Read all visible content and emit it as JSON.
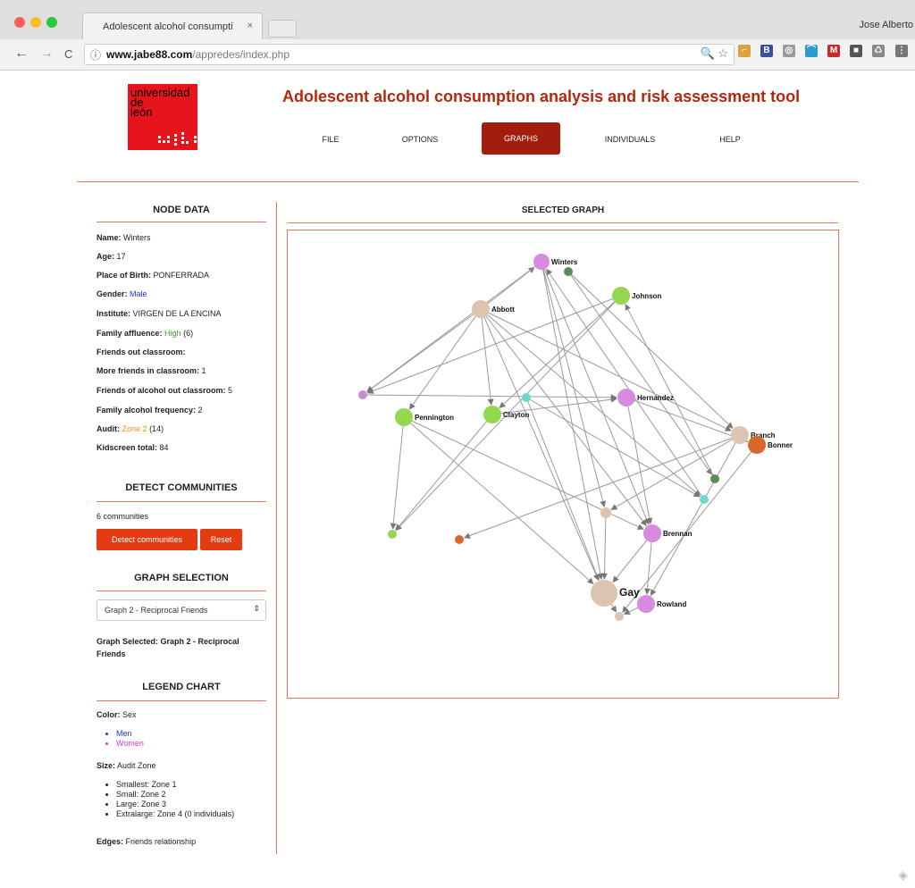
{
  "browser": {
    "tab_title": "Adolescent alcohol consumpti",
    "tab_close": "×",
    "user": "Jose Alberto",
    "url_host": "www.jabe88.com",
    "url_path": "/appredes/index.php",
    "back": "←",
    "forward": "→",
    "reload": "C",
    "info": "ⓘ",
    "omni_icons": "🔍 ☆",
    "extensions": [
      {
        "label": "⌐",
        "color": "#d9a23a"
      },
      {
        "label": "B",
        "color": "#3a4fa0"
      },
      {
        "label": "◎",
        "color": "#9a9a9a"
      },
      {
        "label": "⌒",
        "color": "#2e9ad0"
      },
      {
        "label": "M",
        "color": "#c42b2b"
      },
      {
        "label": "■",
        "color": "#555555"
      },
      {
        "label": "♺",
        "color": "#888888"
      },
      {
        "label": "⋮",
        "color": "#777777"
      }
    ]
  },
  "header": {
    "logo_text_1": "universidad",
    "logo_text_2": "de",
    "logo_text_3": "león",
    "title": "Adolescent alcohol consumption analysis and risk assessment tool",
    "nav": [
      "FILE",
      "OPTIONS",
      "GRAPHS",
      "INDIVIDUALS",
      "HELP"
    ],
    "active_nav": "GRAPHS"
  },
  "node_data": {
    "title": "NODE DATA",
    "name_label": "Name:",
    "name": "Winters",
    "age_label": "Age:",
    "age": "17",
    "pob_label": "Place of Birth:",
    "pob": "PONFERRADA",
    "gender_label": "Gender:",
    "gender": "Male",
    "institute_label": "Institute:",
    "institute": "VIRGEN DE LA ENCINA",
    "affluence_label": "Family affluence:",
    "affluence": "High",
    "affluence_score": "(6)",
    "friends_out_label": "Friends out classroom:",
    "more_friends_label": "More friends in classroom:",
    "more_friends": "1",
    "friends_alcohol_label": "Friends of alcohol out classroom:",
    "friends_alcohol": "5",
    "family_alcohol_label": "Family alcohol frequency:",
    "family_alcohol": "2",
    "audit_label": "Audit:",
    "audit_zone": "Zone 2",
    "audit_score": "(14)",
    "kidscreen_label": "Kidscreen total:",
    "kidscreen": "84"
  },
  "communities": {
    "title": "DETECT COMMUNITIES",
    "count_text": "6 communities",
    "detect_button": "Detect communities",
    "reset_button": "Reset"
  },
  "graph_selection": {
    "title": "GRAPH SELECTION",
    "selected_option": "Graph 2 - Reciprocal Friends",
    "arrow": "⇕",
    "selected_label": "Graph Selected:",
    "selected_value_1": "Graph 2 - Reciprocal",
    "selected_value_2": "Friends"
  },
  "legend": {
    "title": "LEGEND CHART",
    "color_label": "Color:",
    "color_value": "Sex",
    "men": "Men",
    "women": "Women",
    "size_label": "Size:",
    "size_value": "Audit Zone",
    "sizes": [
      "Smallest: Zone 1",
      "Small: Zone 2",
      "Large: Zone 3",
      "Extralarge: Zone 4 (0 individuals)"
    ],
    "edges_label": "Edges:",
    "edges_value": "Friends relationship"
  },
  "graph": {
    "title": "SELECTED GRAPH",
    "nodes": [
      {
        "label": "Winters",
        "color": "#d68be0"
      },
      {
        "label": "",
        "color": "#5b8a5b"
      },
      {
        "label": "Johnson",
        "color": "#93d84f"
      },
      {
        "label": "Abbott",
        "color": "#dcc4b0"
      },
      {
        "label": "",
        "color": "#c98bd6"
      },
      {
        "label": "",
        "color": "#6ed8c8"
      },
      {
        "label": "Hernandez",
        "color": "#d68be0"
      },
      {
        "label": "Pennington",
        "color": "#93d84f"
      },
      {
        "label": "Clayton",
        "color": "#93d84f"
      },
      {
        "label": "Branch",
        "color": "#dcc4b0"
      },
      {
        "label": "Bonner",
        "color": "#d8692b"
      },
      {
        "label": "",
        "color": "#5b8a5b"
      },
      {
        "label": "",
        "color": "#6ed8c8"
      },
      {
        "label": "",
        "color": "#dcc4b0"
      },
      {
        "label": "",
        "color": "#93d84f"
      },
      {
        "label": "",
        "color": "#d8692b"
      },
      {
        "label": "Brennan",
        "color": "#d68be0"
      },
      {
        "label": "Gay",
        "color": "#dcc4b0"
      },
      {
        "label": "Rowland",
        "color": "#d68be0"
      },
      {
        "label": "",
        "color": "#dcc4b0"
      }
    ],
    "edges": [
      [
        3,
        0
      ],
      [
        0,
        4
      ],
      [
        3,
        4
      ],
      [
        3,
        7
      ],
      [
        3,
        8
      ],
      [
        3,
        12
      ],
      [
        3,
        17
      ],
      [
        3,
        16
      ],
      [
        3,
        9
      ],
      [
        0,
        16
      ],
      [
        0,
        17
      ],
      [
        0,
        13
      ],
      [
        1,
        11
      ],
      [
        1,
        9
      ],
      [
        2,
        4
      ],
      [
        2,
        14
      ],
      [
        2,
        8
      ],
      [
        4,
        6
      ],
      [
        6,
        16
      ],
      [
        6,
        10
      ],
      [
        7,
        14
      ],
      [
        7,
        17
      ],
      [
        7,
        16
      ],
      [
        8,
        14
      ],
      [
        8,
        6
      ],
      [
        5,
        12
      ],
      [
        5,
        17
      ],
      [
        9,
        15
      ],
      [
        9,
        18
      ],
      [
        9,
        13
      ],
      [
        13,
        17
      ],
      [
        16,
        18
      ],
      [
        16,
        17
      ],
      [
        17,
        19
      ],
      [
        18,
        19
      ],
      [
        10,
        19
      ],
      [
        11,
        2
      ],
      [
        12,
        0
      ]
    ]
  }
}
